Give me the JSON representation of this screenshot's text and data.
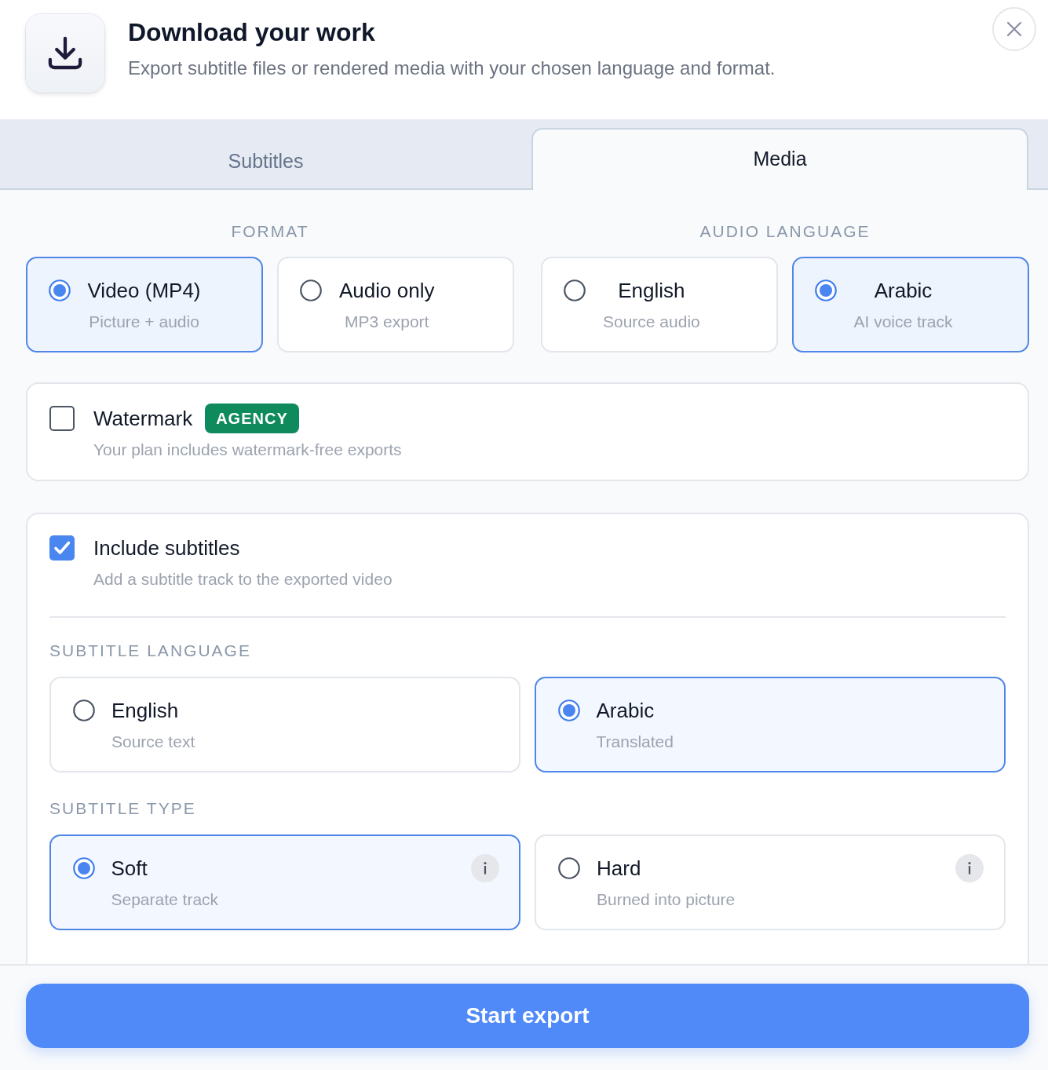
{
  "header": {
    "title": "Download your work",
    "subtitle": "Export subtitle files or rendered media with your chosen language and format."
  },
  "tabs": [
    {
      "label": "Subtitles",
      "selected": false
    },
    {
      "label": "Media",
      "selected": true
    }
  ],
  "format": {
    "heading": "FORMAT",
    "options": [
      {
        "title": "Video (MP4)",
        "subtitle": "Picture + audio",
        "selected": true
      },
      {
        "title": "Audio only",
        "subtitle": "MP3 export",
        "selected": false
      }
    ]
  },
  "audio_language": {
    "heading": "AUDIO LANGUAGE",
    "options": [
      {
        "title": "English",
        "subtitle": "Source audio",
        "selected": false
      },
      {
        "title": "Arabic",
        "subtitle": "AI voice track",
        "selected": true
      }
    ]
  },
  "watermark": {
    "title": "Watermark",
    "badge": "AGENCY",
    "description": "Your plan includes watermark-free exports",
    "checked": false
  },
  "include_subtitles": {
    "title": "Include subtitles",
    "description": "Add a subtitle track to the exported video",
    "checked": true,
    "subtitle_language": {
      "heading": "SUBTITLE LANGUAGE",
      "options": [
        {
          "title": "English",
          "subtitle": "Source text",
          "selected": false
        },
        {
          "title": "Arabic",
          "subtitle": "Translated",
          "selected": true
        }
      ]
    },
    "subtitle_type": {
      "heading": "SUBTITLE TYPE",
      "options": [
        {
          "title": "Soft",
          "subtitle": "Separate track",
          "selected": true
        },
        {
          "title": "Hard",
          "subtitle": "Burned into picture",
          "selected": false
        }
      ]
    }
  },
  "export_button": {
    "label": "Start export"
  }
}
